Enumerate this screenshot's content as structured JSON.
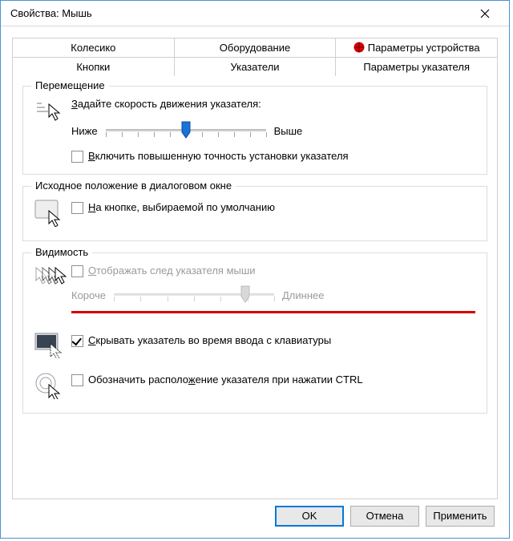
{
  "window": {
    "title": "Свойства: Мышь"
  },
  "tabs": {
    "row1": {
      "wheel": "Колесико",
      "hardware": "Оборудование",
      "device_params": "Параметры устройства"
    },
    "row2": {
      "buttons": "Кнопки",
      "pointers": "Указатели",
      "pointer_options": "Параметры указателя"
    }
  },
  "groups": {
    "motion": {
      "legend": "Перемещение",
      "speed_label": "Задайте скорость движения указателя:",
      "slower": "Ниже",
      "faster": "Выше",
      "enhance_precision": "Включить повышенную точность установки указателя"
    },
    "snapTo": {
      "legend": "Исходное положение в диалоговом окне",
      "label": "На кнопке, выбираемой по умолчанию"
    },
    "visibility": {
      "legend": "Видимость",
      "trails": "Отображать след указателя мыши",
      "shorter": "Короче",
      "longer": "Длиннее",
      "hide_while_typing": "Скрывать указатель во время ввода с клавиатуры",
      "show_location_ctrl": "Обозначить расположение указателя при нажатии CTRL"
    }
  },
  "buttons": {
    "ok": "OK",
    "cancel": "Отмена",
    "apply": "Применить"
  }
}
